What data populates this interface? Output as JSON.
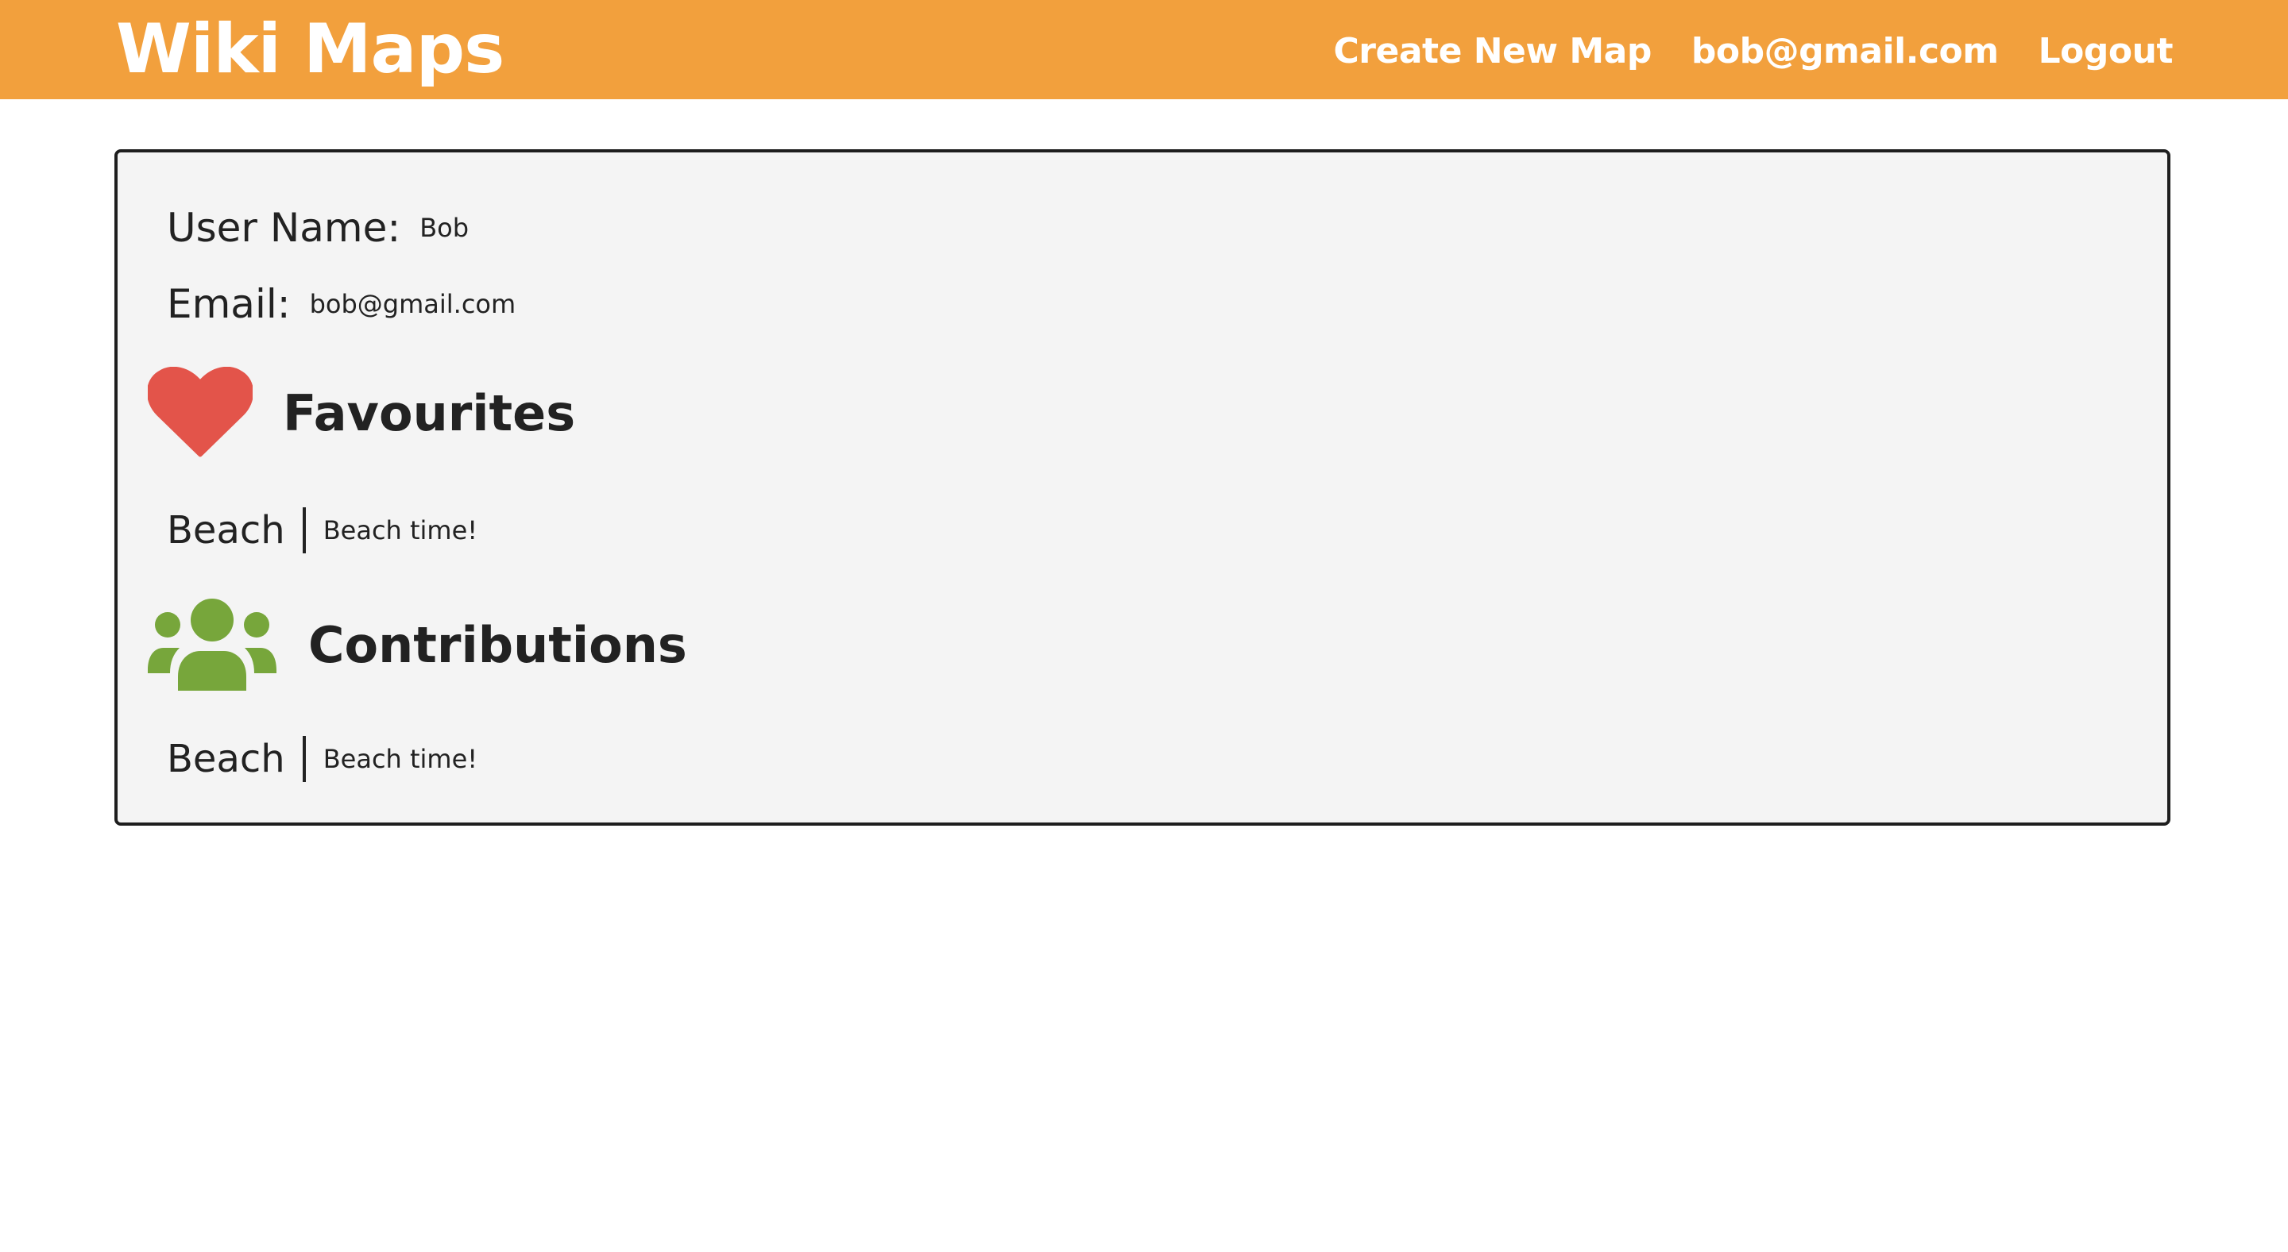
{
  "navbar": {
    "brand": "Wiki Maps",
    "links": {
      "create_new_map": "Create New Map",
      "user_email": "bob@gmail.com",
      "logout": "Logout"
    },
    "background_color": "#f2a03d"
  },
  "profile": {
    "username_label": "User Name:",
    "username_value": "Bob",
    "email_label": "Email:",
    "email_value": "bob@gmail.com"
  },
  "favourites": {
    "title": "Favourites",
    "icon": "heart-icon",
    "icon_color": "#e3544a",
    "items": [
      {
        "name": "Beach",
        "description": "Beach time!"
      }
    ]
  },
  "contributions": {
    "title": "Contributions",
    "icon": "users-icon",
    "icon_color": "#77a63b",
    "items": [
      {
        "name": "Beach",
        "description": "Beach time!"
      }
    ]
  }
}
